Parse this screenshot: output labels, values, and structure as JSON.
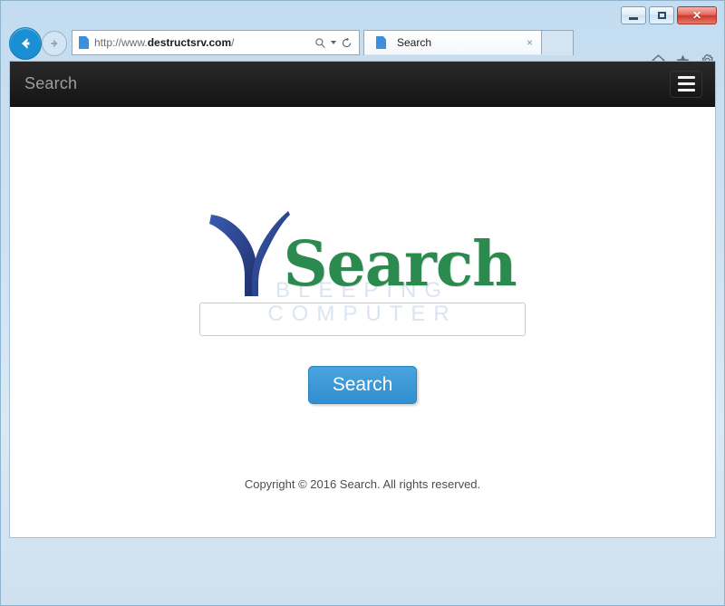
{
  "browser": {
    "url_prefix": "http://www.",
    "url_host": "destructsrv.com",
    "url_suffix": "/",
    "url_full": "http://www.destructsrv.com/",
    "back_icon": "back-arrow-icon",
    "forward_icon": "forward-arrow-icon",
    "page_icon": "page-icon",
    "search_icon": "magnifier-icon",
    "refresh_icon": "refresh-icon",
    "tab": {
      "title": "Search",
      "close_label": "×"
    },
    "window_controls": {
      "minimize_label": "",
      "maximize_label": "",
      "close_label": "✕"
    },
    "toolbar_icons": [
      "home-icon",
      "favorites-star-icon",
      "tools-gear-icon"
    ]
  },
  "site": {
    "navbar": {
      "brand": "Search",
      "menu_icon": "hamburger-menu-icon"
    },
    "logo": {
      "mark": "blue-y-mark-icon",
      "word": "Search",
      "word_color": "#2b8a4e",
      "mark_color": "#2b4a9b"
    },
    "watermark": {
      "line1": "BLEEPING",
      "line2": "COMPUTER"
    },
    "search": {
      "input_value": "",
      "input_placeholder": "",
      "button_label": "Search",
      "button_color": "#2f8fd0"
    },
    "footer": {
      "copyright": "Copyright © 2016 Search. All rights reserved."
    }
  }
}
